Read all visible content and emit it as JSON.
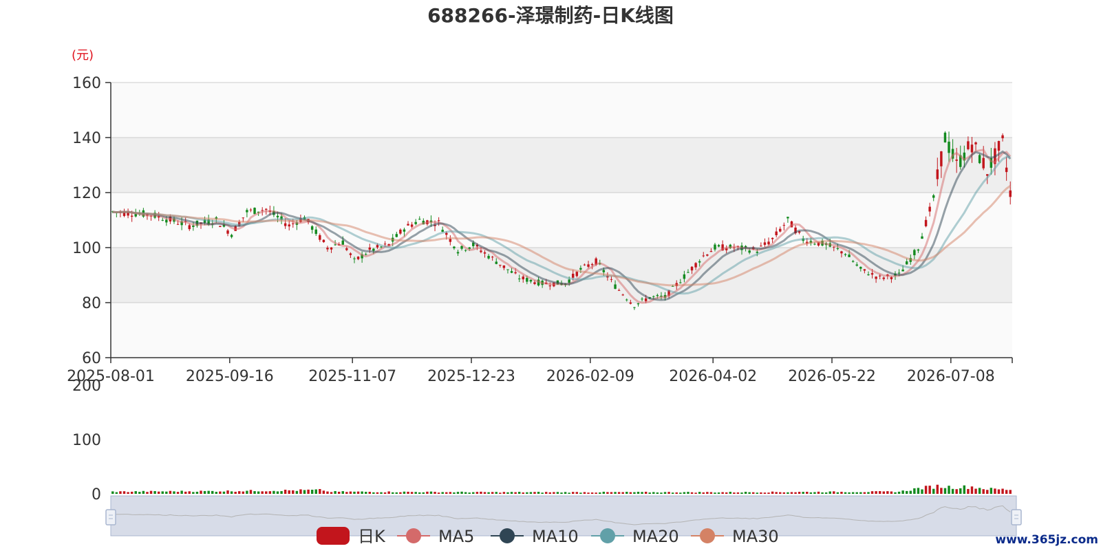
{
  "title": "688266-泽璟制药-日K线图",
  "unit_label": "(元)",
  "watermark": "www.365jz.com",
  "colors": {
    "up": "#c2151c",
    "down": "#138a1f",
    "ma5": "#d46a6a",
    "ma10": "#2f4554",
    "ma20": "#61a0a8",
    "ma30": "#d48265",
    "grid": "#cccccc",
    "band": "#eeeeee",
    "slider_fill": "#d7dce8",
    "slider_border": "#a8b6cf"
  },
  "legend": [
    {
      "name": "日K",
      "icon": "bar-icon"
    },
    {
      "name": "MA5",
      "icon": "line-dot-icon"
    },
    {
      "name": "MA10",
      "icon": "line-dot-icon"
    },
    {
      "name": "MA20",
      "icon": "line-dot-icon"
    },
    {
      "name": "MA30",
      "icon": "line-dot-icon"
    }
  ],
  "chart_data": [
    {
      "type": "candlestick",
      "title": "688266-泽璟制药-日K线图",
      "ylabel": "(元)",
      "ylim": [
        60,
        160
      ],
      "yticks": [
        "160",
        "140",
        "120",
        "100",
        "80",
        "60"
      ],
      "yticks_values": [
        160,
        140,
        120,
        100,
        80,
        60
      ],
      "xticks": [
        "2025-08-01",
        "2025-09-16",
        "2025-11-07",
        "2025-12-23",
        "2026-02-09",
        "2026-04-02",
        "2026-05-22",
        "2026-07-08"
      ],
      "xticks_index": [
        0,
        31,
        63,
        94,
        125,
        157,
        188,
        219
      ],
      "n_days": 235,
      "grid": true,
      "anchors": [
        [
          0,
          113
        ],
        [
          10,
          112
        ],
        [
          20,
          108
        ],
        [
          27,
          110
        ],
        [
          31,
          105
        ],
        [
          35,
          113
        ],
        [
          40,
          114
        ],
        [
          46,
          108
        ],
        [
          50,
          111
        ],
        [
          56,
          100
        ],
        [
          60,
          102
        ],
        [
          63,
          95
        ],
        [
          67,
          99
        ],
        [
          72,
          101
        ],
        [
          76,
          107
        ],
        [
          80,
          110
        ],
        [
          85,
          109
        ],
        [
          90,
          99
        ],
        [
          94,
          101
        ],
        [
          100,
          95
        ],
        [
          106,
          89
        ],
        [
          112,
          87
        ],
        [
          118,
          87
        ],
        [
          122,
          92
        ],
        [
          126,
          95
        ],
        [
          131,
          86
        ],
        [
          136,
          79
        ],
        [
          140,
          82
        ],
        [
          144,
          82
        ],
        [
          150,
          91
        ],
        [
          154,
          97
        ],
        [
          157,
          100
        ],
        [
          162,
          100
        ],
        [
          168,
          99
        ],
        [
          172,
          103
        ],
        [
          176,
          110
        ],
        [
          180,
          103
        ],
        [
          186,
          101
        ],
        [
          191,
          98
        ],
        [
          195,
          92
        ],
        [
          200,
          89
        ],
        [
          205,
          90
        ],
        [
          210,
          100
        ],
        [
          214,
          118
        ],
        [
          217,
          140
        ],
        [
          220,
          130
        ],
        [
          224,
          138
        ],
        [
          228,
          128
        ],
        [
          232,
          138
        ],
        [
          234,
          120
        ]
      ],
      "series": [
        {
          "name": "日K"
        },
        {
          "name": "MA5",
          "window": 5
        },
        {
          "name": "MA10",
          "window": 10
        },
        {
          "name": "MA20",
          "window": 20
        },
        {
          "name": "MA30",
          "window": 30
        }
      ]
    },
    {
      "type": "bar",
      "ylim": [
        0,
        200
      ],
      "yticks": [
        "200",
        "100",
        "0"
      ],
      "yticks_values": [
        200,
        100,
        0
      ],
      "volume_anchors": [
        [
          0,
          4
        ],
        [
          27,
          5
        ],
        [
          55,
          7
        ],
        [
          56,
          4
        ],
        [
          100,
          3
        ],
        [
          130,
          3
        ],
        [
          160,
          3
        ],
        [
          205,
          4
        ],
        [
          210,
          10
        ],
        [
          215,
          14
        ],
        [
          220,
          12
        ],
        [
          224,
          13
        ],
        [
          228,
          9
        ],
        [
          234,
          8
        ]
      ]
    }
  ]
}
